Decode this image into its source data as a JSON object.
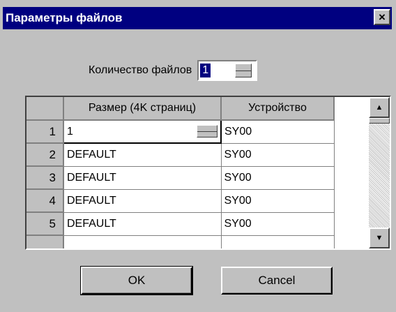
{
  "window": {
    "title": "Параметры файлов",
    "close_icon": "×"
  },
  "file_count": {
    "label": "Количество файлов",
    "value": "1"
  },
  "grid": {
    "columns": [
      "Размер (4K страниц)",
      "Устройство"
    ],
    "rows": [
      {
        "num": "1",
        "size": "1",
        "device": "SY00"
      },
      {
        "num": "2",
        "size": "DEFAULT",
        "device": "SY00"
      },
      {
        "num": "3",
        "size": "DEFAULT",
        "device": "SY00"
      },
      {
        "num": "4",
        "size": "DEFAULT",
        "device": "SY00"
      },
      {
        "num": "5",
        "size": "DEFAULT",
        "device": "SY00"
      }
    ]
  },
  "scroll": {
    "up_icon": "▲",
    "down_icon": "▼"
  },
  "buttons": {
    "ok": "OK",
    "cancel": "Cancel"
  }
}
